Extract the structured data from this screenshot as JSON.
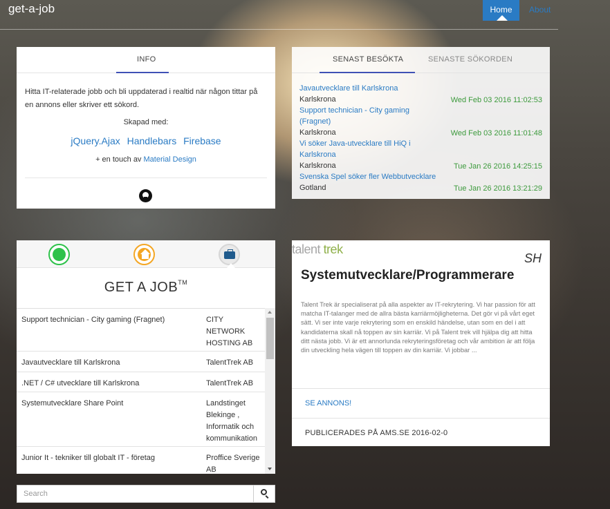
{
  "navbar": {
    "brand": "get-a-job",
    "home_label": "Home",
    "about_label": "About"
  },
  "info": {
    "tab": "INFO",
    "text": "Hitta IT-relaterade jobb och bli uppdaterad i realtid när någon tittar på en annons eller skriver ett sökord.",
    "made_with": "Skapad med:",
    "techs": [
      "jQuery.Ajax",
      "Handlebars",
      "Firebase"
    ],
    "touch_prefix": "+ en touch av",
    "touch_link": "Material Design",
    "github_icon": "github-icon"
  },
  "visited": {
    "tabs": [
      "SENAST BESÖKTA",
      "SENASTE SÖKORDEN"
    ],
    "items": [
      {
        "title": "Javautvecklare till Karlskrona",
        "city": "Karlskrona",
        "date": "Wed Feb 03 2016 11:02:53"
      },
      {
        "title": "Support technician - City gaming (Fragnet)",
        "city": "Karlskrona",
        "date": "Wed Feb 03 2016 11:01:48"
      },
      {
        "title": "Vi söker Java-utvecklare till HiQ i Karlskrona",
        "city": "Karlskrona",
        "date": "Tue Jan 26 2016 14:25:15"
      },
      {
        "title": "Svenska Spel söker fler Webbutvecklare",
        "city": "Gotland",
        "date": "Tue Jan 26 2016 13:21:29"
      }
    ]
  },
  "jobs": {
    "icons": [
      "globe-icon",
      "home-icon",
      "briefcase-icon"
    ],
    "title": "GET A JOB",
    "title_mark": "TM",
    "rows": [
      {
        "title": "Support technician - City gaming (Fragnet)",
        "company": "CITY NETWORK HOSTING AB"
      },
      {
        "title": "Javautvecklare till Karlskrona",
        "company": "TalentTrek AB"
      },
      {
        "title": ".NET / C# utvecklare till Karlskrona",
        "company": "TalentTrek AB"
      },
      {
        "title": "Systemutvecklare Share Point",
        "company": "Landstinget Blekinge , Informatik och kommunikation"
      },
      {
        "title": "Junior It - tekniker till globalt IT - företag",
        "company": "Proffice Sverige AB"
      }
    ]
  },
  "search": {
    "placeholder": "Search",
    "icon": "search-icon"
  },
  "detail": {
    "logo_a": "talent",
    "logo_b": "trek",
    "sh": "SH",
    "title": "Systemutvecklare/Programmerare",
    "body": "Talent Trek är specialiserat på alla aspekter av IT-rekrytering. Vi har passion för att matcha  IT-talanger med de allra bästa karriärmöjligheterna. Det gör vi på vårt eget sätt. Vi ser inte varje rekrytering som en enskild händelse, utan som en del i att kandidaterna skall nå toppen av sin karriär. Vi på Talent trek vill hjälpa dig att hitta ditt nästa jobb. Vi är ett annorlunda rekryteringsföretag och vår ambition är att följa din utveckling hela vägen till toppen av din karriär. Vi jobbar ...",
    "link": "SE ANNONS!",
    "published": "PUBLICERADES PÅ AMS.SE 2016-02-0"
  }
}
